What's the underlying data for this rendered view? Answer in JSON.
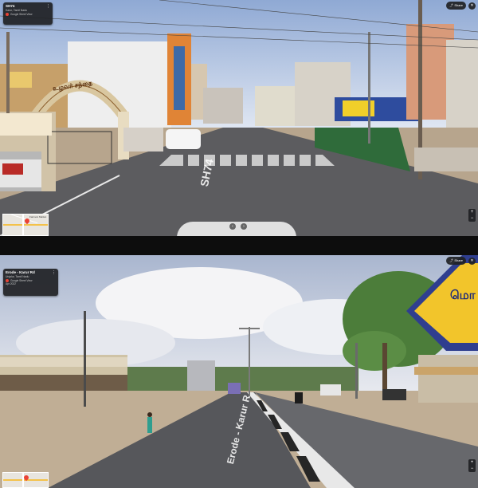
{
  "top_panel": {
    "info_card": {
      "title": "SH74",
      "subtitle": "Karur, Tamil Nadu",
      "brand": "Google Street View"
    },
    "share_label": "Share",
    "road_marking": "SH74",
    "arch_text": "உழவர் சந்தை",
    "minimap_label": "Farmers Market"
  },
  "bottom_panel": {
    "info_card": {
      "title": "Erode - Karur Rd",
      "subtitle": "Unjalur, Tamil Nadu",
      "brand": "Google Street View",
      "date": "Apr 2022"
    },
    "share_label": "Share",
    "road_marking": "Erode - Karur R",
    "sign_text": "மொ"
  },
  "icons": {
    "back": "back-arrow-icon",
    "more": "more-vert-icon",
    "share": "share-icon",
    "close": "close-icon",
    "zoom_in": "plus-icon",
    "zoom_out": "minus-icon",
    "pin": "map-pin-icon"
  },
  "colors": {
    "card_bg": "#202124",
    "brand_red": "#ea4335",
    "sky_bottom": "#c9d2e2",
    "road": "#5c5c5f"
  }
}
